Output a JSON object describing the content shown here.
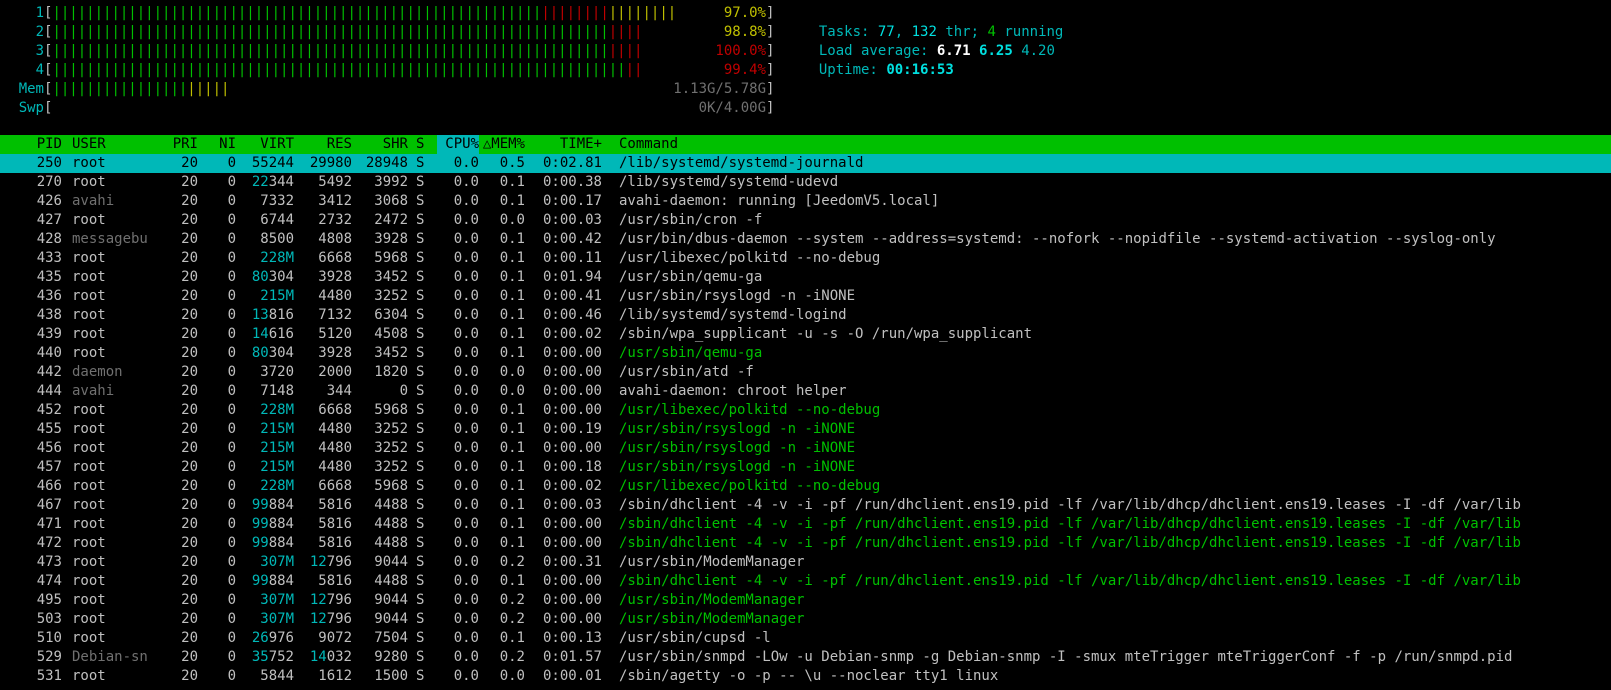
{
  "cpu_meters": [
    {
      "label": "1",
      "percent": "97.0%",
      "bars": {
        "green": 58,
        "red": 8,
        "yellow": 8
      },
      "pct_color": "yellow"
    },
    {
      "label": "2",
      "percent": "98.8%",
      "bars": {
        "green": 66,
        "red": 4,
        "yellow": 0
      },
      "pct_color": "yellow"
    },
    {
      "label": "3",
      "percent": "100.0%",
      "bars": {
        "green": 66,
        "red": 4,
        "yellow": 0
      },
      "pct_color": "red"
    },
    {
      "label": "4",
      "percent": "99.4%",
      "bars": {
        "green": 68,
        "red": 2,
        "yellow": 0
      },
      "pct_color": "red"
    }
  ],
  "mem_meter": {
    "label": "Mem",
    "value": "1.13G/5.78G",
    "bars": {
      "green": 16,
      "yellow": 5
    }
  },
  "swp_meter": {
    "label": "Swp",
    "value": "0K/4.00G"
  },
  "tasks": {
    "label": "Tasks:",
    "tasks": "77",
    "thr": "132",
    "thr_label": "thr;",
    "running": "4",
    "running_label": "running"
  },
  "load": {
    "label": "Load average:",
    "l1": "6.71",
    "l5": "6.25",
    "l15": "4.20"
  },
  "uptime": {
    "label": "Uptime:",
    "value": "00:16:53"
  },
  "columns": [
    "PID",
    "USER",
    "PRI",
    "NI",
    "VIRT",
    "RES",
    "SHR",
    "S",
    "CPU%",
    "MEM%",
    "TIME+",
    "Command"
  ],
  "sort_indicator": "△",
  "processes": [
    {
      "pid": "250",
      "user": "root",
      "pri": "20",
      "ni": "0",
      "virt": "55244",
      "res": "29980",
      "shr": "28948",
      "s": "S",
      "cpu": "0.0",
      "mem": "0.5",
      "time": "0:02.81",
      "cmd": "/lib/systemd/systemd-journald",
      "selected": true
    },
    {
      "pid": "270",
      "user": "root",
      "pri": "20",
      "ni": "0",
      "virt": "22344",
      "res": "5492",
      "shr": "3992",
      "s": "S",
      "cpu": "0.0",
      "mem": "0.1",
      "time": "0:00.38",
      "cmd": "/lib/systemd/systemd-udevd"
    },
    {
      "pid": "426",
      "user": "avahi",
      "pri": "20",
      "ni": "0",
      "virt": "7332",
      "res": "3412",
      "shr": "3068",
      "s": "S",
      "cpu": "0.0",
      "mem": "0.1",
      "time": "0:00.17",
      "cmd": "avahi-daemon: running [JeedomV5.local]",
      "user_gray": true
    },
    {
      "pid": "427",
      "user": "root",
      "pri": "20",
      "ni": "0",
      "virt": "6744",
      "res": "2732",
      "shr": "2472",
      "s": "S",
      "cpu": "0.0",
      "mem": "0.0",
      "time": "0:00.03",
      "cmd": "/usr/sbin/cron -f"
    },
    {
      "pid": "428",
      "user": "messagebu",
      "pri": "20",
      "ni": "0",
      "virt": "8500",
      "res": "4808",
      "shr": "3928",
      "s": "S",
      "cpu": "0.0",
      "mem": "0.1",
      "time": "0:00.42",
      "cmd": "/usr/bin/dbus-daemon --system --address=systemd: --nofork --nopidfile --systemd-activation --syslog-only",
      "user_gray": true
    },
    {
      "pid": "433",
      "user": "root",
      "pri": "20",
      "ni": "0",
      "virt": "228M",
      "res": "6668",
      "shr": "5968",
      "s": "S",
      "cpu": "0.0",
      "mem": "0.1",
      "time": "0:00.11",
      "cmd": "/usr/libexec/polkitd --no-debug"
    },
    {
      "pid": "435",
      "user": "root",
      "pri": "20",
      "ni": "0",
      "virt": "80304",
      "res": "3928",
      "shr": "3452",
      "s": "S",
      "cpu": "0.0",
      "mem": "0.1",
      "time": "0:01.94",
      "cmd": "/usr/sbin/qemu-ga"
    },
    {
      "pid": "436",
      "user": "root",
      "pri": "20",
      "ni": "0",
      "virt": "215M",
      "res": "4480",
      "shr": "3252",
      "s": "S",
      "cpu": "0.0",
      "mem": "0.1",
      "time": "0:00.41",
      "cmd": "/usr/sbin/rsyslogd -n -iNONE"
    },
    {
      "pid": "438",
      "user": "root",
      "pri": "20",
      "ni": "0",
      "virt": "13816",
      "res": "7132",
      "shr": "6304",
      "s": "S",
      "cpu": "0.0",
      "mem": "0.1",
      "time": "0:00.46",
      "cmd": "/lib/systemd/systemd-logind"
    },
    {
      "pid": "439",
      "user": "root",
      "pri": "20",
      "ni": "0",
      "virt": "14616",
      "res": "5120",
      "shr": "4508",
      "s": "S",
      "cpu": "0.0",
      "mem": "0.1",
      "time": "0:00.02",
      "cmd": "/sbin/wpa_supplicant -u -s -O /run/wpa_supplicant"
    },
    {
      "pid": "440",
      "user": "root",
      "pri": "20",
      "ni": "0",
      "virt": "80304",
      "res": "3928",
      "shr": "3452",
      "s": "S",
      "cpu": "0.0",
      "mem": "0.1",
      "time": "0:00.00",
      "cmd": "/usr/sbin/qemu-ga",
      "thread": true
    },
    {
      "pid": "442",
      "user": "daemon",
      "pri": "20",
      "ni": "0",
      "virt": "3720",
      "res": "2000",
      "shr": "1820",
      "s": "S",
      "cpu": "0.0",
      "mem": "0.0",
      "time": "0:00.00",
      "cmd": "/usr/sbin/atd -f",
      "user_gray": true
    },
    {
      "pid": "444",
      "user": "avahi",
      "pri": "20",
      "ni": "0",
      "virt": "7148",
      "res": "344",
      "shr": "0",
      "s": "S",
      "cpu": "0.0",
      "mem": "0.0",
      "time": "0:00.00",
      "cmd": "avahi-daemon: chroot helper",
      "user_gray": true
    },
    {
      "pid": "452",
      "user": "root",
      "pri": "20",
      "ni": "0",
      "virt": "228M",
      "res": "6668",
      "shr": "5968",
      "s": "S",
      "cpu": "0.0",
      "mem": "0.1",
      "time": "0:00.00",
      "cmd": "/usr/libexec/polkitd --no-debug",
      "thread": true
    },
    {
      "pid": "455",
      "user": "root",
      "pri": "20",
      "ni": "0",
      "virt": "215M",
      "res": "4480",
      "shr": "3252",
      "s": "S",
      "cpu": "0.0",
      "mem": "0.1",
      "time": "0:00.19",
      "cmd": "/usr/sbin/rsyslogd -n -iNONE",
      "thread": true
    },
    {
      "pid": "456",
      "user": "root",
      "pri": "20",
      "ni": "0",
      "virt": "215M",
      "res": "4480",
      "shr": "3252",
      "s": "S",
      "cpu": "0.0",
      "mem": "0.1",
      "time": "0:00.00",
      "cmd": "/usr/sbin/rsyslogd -n -iNONE",
      "thread": true
    },
    {
      "pid": "457",
      "user": "root",
      "pri": "20",
      "ni": "0",
      "virt": "215M",
      "res": "4480",
      "shr": "3252",
      "s": "S",
      "cpu": "0.0",
      "mem": "0.1",
      "time": "0:00.18",
      "cmd": "/usr/sbin/rsyslogd -n -iNONE",
      "thread": true
    },
    {
      "pid": "466",
      "user": "root",
      "pri": "20",
      "ni": "0",
      "virt": "228M",
      "res": "6668",
      "shr": "5968",
      "s": "S",
      "cpu": "0.0",
      "mem": "0.1",
      "time": "0:00.02",
      "cmd": "/usr/libexec/polkitd --no-debug",
      "thread": true
    },
    {
      "pid": "467",
      "user": "root",
      "pri": "20",
      "ni": "0",
      "virt": "99884",
      "res": "5816",
      "shr": "4488",
      "s": "S",
      "cpu": "0.0",
      "mem": "0.1",
      "time": "0:00.03",
      "cmd": "/sbin/dhclient -4 -v -i -pf /run/dhclient.ens19.pid -lf /var/lib/dhcp/dhclient.ens19.leases -I -df /var/lib"
    },
    {
      "pid": "471",
      "user": "root",
      "pri": "20",
      "ni": "0",
      "virt": "99884",
      "res": "5816",
      "shr": "4488",
      "s": "S",
      "cpu": "0.0",
      "mem": "0.1",
      "time": "0:00.00",
      "cmd": "/sbin/dhclient -4 -v -i -pf /run/dhclient.ens19.pid -lf /var/lib/dhcp/dhclient.ens19.leases -I -df /var/lib",
      "thread": true
    },
    {
      "pid": "472",
      "user": "root",
      "pri": "20",
      "ni": "0",
      "virt": "99884",
      "res": "5816",
      "shr": "4488",
      "s": "S",
      "cpu": "0.0",
      "mem": "0.1",
      "time": "0:00.00",
      "cmd": "/sbin/dhclient -4 -v -i -pf /run/dhclient.ens19.pid -lf /var/lib/dhcp/dhclient.ens19.leases -I -df /var/lib",
      "thread": true
    },
    {
      "pid": "473",
      "user": "root",
      "pri": "20",
      "ni": "0",
      "virt": "307M",
      "res": "12796",
      "shr": "9044",
      "s": "S",
      "cpu": "0.0",
      "mem": "0.2",
      "time": "0:00.31",
      "cmd": "/usr/sbin/ModemManager"
    },
    {
      "pid": "474",
      "user": "root",
      "pri": "20",
      "ni": "0",
      "virt": "99884",
      "res": "5816",
      "shr": "4488",
      "s": "S",
      "cpu": "0.0",
      "mem": "0.1",
      "time": "0:00.00",
      "cmd": "/sbin/dhclient -4 -v -i -pf /run/dhclient.ens19.pid -lf /var/lib/dhcp/dhclient.ens19.leases -I -df /var/lib",
      "thread": true
    },
    {
      "pid": "495",
      "user": "root",
      "pri": "20",
      "ni": "0",
      "virt": "307M",
      "res": "12796",
      "shr": "9044",
      "s": "S",
      "cpu": "0.0",
      "mem": "0.2",
      "time": "0:00.00",
      "cmd": "/usr/sbin/ModemManager",
      "thread": true
    },
    {
      "pid": "503",
      "user": "root",
      "pri": "20",
      "ni": "0",
      "virt": "307M",
      "res": "12796",
      "shr": "9044",
      "s": "S",
      "cpu": "0.0",
      "mem": "0.2",
      "time": "0:00.00",
      "cmd": "/usr/sbin/ModemManager",
      "thread": true
    },
    {
      "pid": "510",
      "user": "root",
      "pri": "20",
      "ni": "0",
      "virt": "26976",
      "res": "9072",
      "shr": "7504",
      "s": "S",
      "cpu": "0.0",
      "mem": "0.1",
      "time": "0:00.13",
      "cmd": "/usr/sbin/cupsd -l"
    },
    {
      "pid": "529",
      "user": "Debian-sn",
      "pri": "20",
      "ni": "0",
      "virt": "35752",
      "res": "14032",
      "shr": "9280",
      "s": "S",
      "cpu": "0.0",
      "mem": "0.2",
      "time": "0:01.57",
      "cmd": "/usr/sbin/snmpd -LOw -u Debian-snmp -g Debian-snmp -I -smux mteTrigger mteTriggerConf -f -p /run/snmpd.pid",
      "user_gray": true
    },
    {
      "pid": "531",
      "user": "root",
      "pri": "20",
      "ni": "0",
      "virt": "5844",
      "res": "1612",
      "shr": "1500",
      "s": "S",
      "cpu": "0.0",
      "mem": "0.0",
      "time": "0:00.01",
      "cmd": "/sbin/agetty -o -p -- \\u --noclear tty1 linux"
    }
  ],
  "colors": {
    "green": "#00c000",
    "cyan": "#00b8b8",
    "red": "#c00000",
    "yellow": "#c0c000",
    "gray": "#707070"
  }
}
